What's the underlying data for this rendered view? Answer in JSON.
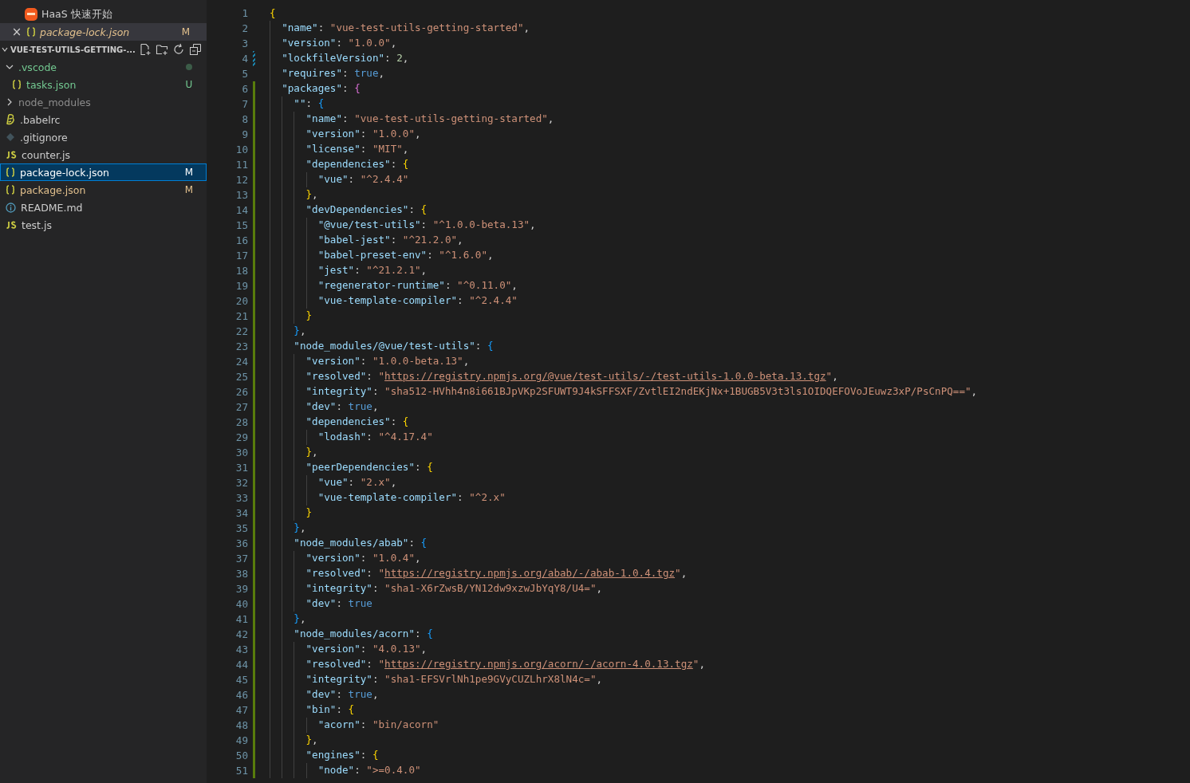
{
  "open_editors": [
    {
      "label": "HaaS 快速开始",
      "kind": "haas",
      "italic": false,
      "active": false
    },
    {
      "label": "package-lock.json",
      "kind": "json",
      "italic": true,
      "active": true,
      "badge": "M",
      "close": "×"
    }
  ],
  "explorer": {
    "title": "VUE-TEST-UTILS-GETTING-...",
    "items": [
      {
        "label": ".vscode",
        "kind": "folder",
        "expanded": true,
        "color": "#73c991",
        "selected": false,
        "dot": true,
        "children": [
          {
            "label": "tasks.json",
            "kind": "json",
            "color": "#73c991",
            "selected": false,
            "badge": "U"
          }
        ]
      },
      {
        "label": "node_modules",
        "kind": "folder",
        "expanded": false,
        "color": "#8c8c8c",
        "selected": false
      },
      {
        "label": ".babelrc",
        "kind": "babel",
        "color": "#cccccc",
        "selected": false
      },
      {
        "label": ".gitignore",
        "kind": "git",
        "color": "#cccccc",
        "selected": false
      },
      {
        "label": "counter.js",
        "kind": "js",
        "color": "#cccccc",
        "selected": false
      },
      {
        "label": "package-lock.json",
        "kind": "json",
        "color": "#ffffff",
        "selected": true,
        "badge": "M"
      },
      {
        "label": "package.json",
        "kind": "json",
        "color": "#e2c08d",
        "selected": false,
        "badge": "M"
      },
      {
        "label": "README.md",
        "kind": "info",
        "color": "#cccccc",
        "selected": false
      },
      {
        "label": "test.js",
        "kind": "js",
        "color": "#cccccc",
        "selected": false
      }
    ]
  },
  "editor": {
    "lines": [
      {
        "n": "1",
        "text": "{",
        "added": false,
        "modified": false
      },
      {
        "n": "2",
        "text": "  \"name\": \"vue-test-utils-getting-started\",",
        "added": false,
        "modified": false
      },
      {
        "n": "3",
        "text": "  \"version\": \"1.0.0\",",
        "added": false,
        "modified": false
      },
      {
        "n": "4",
        "text": "  \"lockfileVersion\": 2,",
        "added": false,
        "modified": true
      },
      {
        "n": "5",
        "text": "  \"requires\": true,",
        "added": false,
        "modified": false
      },
      {
        "n": "6",
        "text": "  \"packages\": {",
        "added": true,
        "modified": false
      },
      {
        "n": "7",
        "text": "    \"\": {",
        "added": true,
        "modified": false
      },
      {
        "n": "8",
        "text": "      \"name\": \"vue-test-utils-getting-started\",",
        "added": true,
        "modified": false
      },
      {
        "n": "9",
        "text": "      \"version\": \"1.0.0\",",
        "added": true,
        "modified": false
      },
      {
        "n": "10",
        "text": "      \"license\": \"MIT\",",
        "added": true,
        "modified": false
      },
      {
        "n": "11",
        "text": "      \"dependencies\": {",
        "added": true,
        "modified": false
      },
      {
        "n": "12",
        "text": "        \"vue\": \"^2.4.4\"",
        "added": true,
        "modified": false
      },
      {
        "n": "13",
        "text": "      },",
        "added": true,
        "modified": false
      },
      {
        "n": "14",
        "text": "      \"devDependencies\": {",
        "added": true,
        "modified": false
      },
      {
        "n": "15",
        "text": "        \"@vue/test-utils\": \"^1.0.0-beta.13\",",
        "added": true,
        "modified": false
      },
      {
        "n": "16",
        "text": "        \"babel-jest\": \"^21.2.0\",",
        "added": true,
        "modified": false
      },
      {
        "n": "17",
        "text": "        \"babel-preset-env\": \"^1.6.0\",",
        "added": true,
        "modified": false
      },
      {
        "n": "18",
        "text": "        \"jest\": \"^21.2.1\",",
        "added": true,
        "modified": false
      },
      {
        "n": "19",
        "text": "        \"regenerator-runtime\": \"^0.11.0\",",
        "added": true,
        "modified": false
      },
      {
        "n": "20",
        "text": "        \"vue-template-compiler\": \"^2.4.4\"",
        "added": true,
        "modified": false
      },
      {
        "n": "21",
        "text": "      }",
        "added": true,
        "modified": false
      },
      {
        "n": "22",
        "text": "    },",
        "added": true,
        "modified": false
      },
      {
        "n": "23",
        "text": "    \"node_modules/@vue/test-utils\": {",
        "added": true,
        "modified": false
      },
      {
        "n": "24",
        "text": "      \"version\": \"1.0.0-beta.13\",",
        "added": true,
        "modified": false
      },
      {
        "n": "25",
        "text": "      \"resolved\": \"https://registry.npmjs.org/@vue/test-utils/-/test-utils-1.0.0-beta.13.tgz\",",
        "added": true,
        "modified": false
      },
      {
        "n": "26",
        "text": "      \"integrity\": \"sha512-HVhh4n8i661BJpVKp2SFUWT9J4kSFFSXF/ZvtlEI2ndEKjNx+1BUGB5V3t3ls1OIDQEFOVoJEuwz3xP/PsCnPQ==\",",
        "added": true,
        "modified": false
      },
      {
        "n": "27",
        "text": "      \"dev\": true,",
        "added": true,
        "modified": false
      },
      {
        "n": "28",
        "text": "      \"dependencies\": {",
        "added": true,
        "modified": false
      },
      {
        "n": "29",
        "text": "        \"lodash\": \"^4.17.4\"",
        "added": true,
        "modified": false
      },
      {
        "n": "30",
        "text": "      },",
        "added": true,
        "modified": false
      },
      {
        "n": "31",
        "text": "      \"peerDependencies\": {",
        "added": true,
        "modified": false
      },
      {
        "n": "32",
        "text": "        \"vue\": \"2.x\",",
        "added": true,
        "modified": false
      },
      {
        "n": "33",
        "text": "        \"vue-template-compiler\": \"^2.x\"",
        "added": true,
        "modified": false
      },
      {
        "n": "34",
        "text": "      }",
        "added": true,
        "modified": false
      },
      {
        "n": "35",
        "text": "    },",
        "added": true,
        "modified": false
      },
      {
        "n": "36",
        "text": "    \"node_modules/abab\": {",
        "added": true,
        "modified": false
      },
      {
        "n": "37",
        "text": "      \"version\": \"1.0.4\",",
        "added": true,
        "modified": false
      },
      {
        "n": "38",
        "text": "      \"resolved\": \"https://registry.npmjs.org/abab/-/abab-1.0.4.tgz\",",
        "added": true,
        "modified": false
      },
      {
        "n": "39",
        "text": "      \"integrity\": \"sha1-X6rZwsB/YN12dw9xzwJbYqY8/U4=\",",
        "added": true,
        "modified": false
      },
      {
        "n": "40",
        "text": "      \"dev\": true",
        "added": true,
        "modified": false
      },
      {
        "n": "41",
        "text": "    },",
        "added": true,
        "modified": false
      },
      {
        "n": "42",
        "text": "    \"node_modules/acorn\": {",
        "added": true,
        "modified": false
      },
      {
        "n": "43",
        "text": "      \"version\": \"4.0.13\",",
        "added": true,
        "modified": false
      },
      {
        "n": "44",
        "text": "      \"resolved\": \"https://registry.npmjs.org/acorn/-/acorn-4.0.13.tgz\",",
        "added": true,
        "modified": false
      },
      {
        "n": "45",
        "text": "      \"integrity\": \"sha1-EFSVrlNh1pe9GVyCUZLhrX8lN4c=\",",
        "added": true,
        "modified": false
      },
      {
        "n": "46",
        "text": "      \"dev\": true,",
        "added": true,
        "modified": false
      },
      {
        "n": "47",
        "text": "      \"bin\": {",
        "added": true,
        "modified": false
      },
      {
        "n": "48",
        "text": "        \"acorn\": \"bin/acorn\"",
        "added": true,
        "modified": false
      },
      {
        "n": "49",
        "text": "      },",
        "added": true,
        "modified": false
      },
      {
        "n": "50",
        "text": "      \"engines\": {",
        "added": true,
        "modified": false
      },
      {
        "n": "51",
        "text": "        \"node\": \">=0.4.0\"",
        "added": true,
        "modified": false
      }
    ]
  }
}
